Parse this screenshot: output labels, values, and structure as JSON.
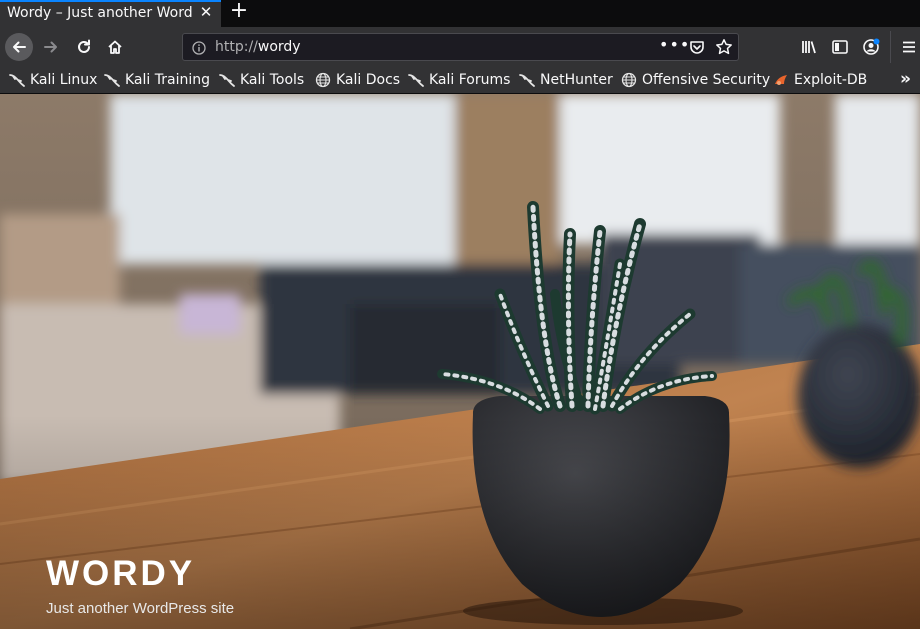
{
  "browser": {
    "tab_title": "Wordy – Just another WordPress site",
    "tab_close": "✕",
    "new_tab": "+",
    "url_protocol": "http://",
    "url_host": "wordy",
    "url_more": "•••"
  },
  "bookmarks": [
    {
      "label": "Kali Linux",
      "icon": "kali-dragon-icon"
    },
    {
      "label": "Kali Training",
      "icon": "kali-dragon-icon"
    },
    {
      "label": "Kali Tools",
      "icon": "kali-dragon-icon"
    },
    {
      "label": "Kali Docs",
      "icon": "globe-icon"
    },
    {
      "label": "Kali Forums",
      "icon": "kali-dragon-icon"
    },
    {
      "label": "NetHunter",
      "icon": "kali-dragon-icon"
    },
    {
      "label": "Offensive Security",
      "icon": "globe-icon"
    },
    {
      "label": "Exploit-DB",
      "icon": "exploit-db-icon"
    }
  ],
  "bookmarks_overflow": "»",
  "site": {
    "title": "WORDY",
    "description": "Just another WordPress site"
  },
  "colors": {
    "chrome": "#323234",
    "tab_accent": "#0a84ff",
    "url_bg": "#1c1b22"
  }
}
